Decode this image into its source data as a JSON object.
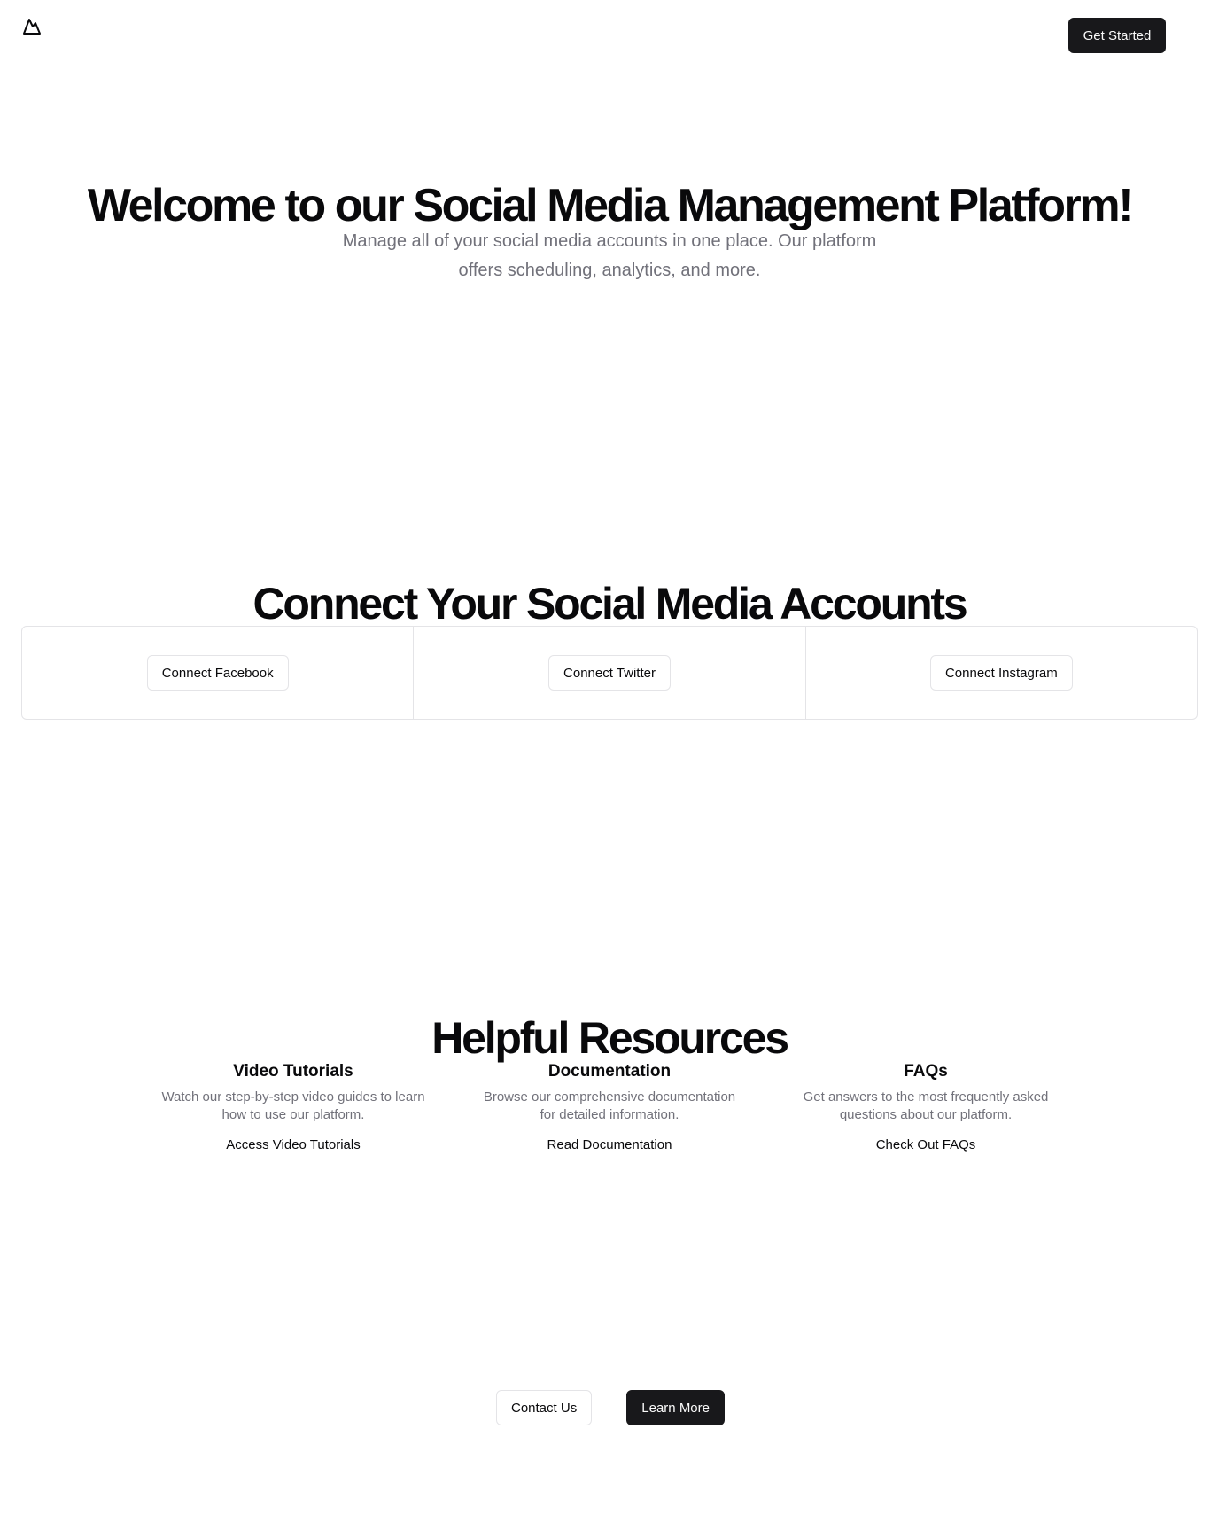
{
  "header": {
    "logo_icon": "mountain-icon",
    "cta_label": "Get Started"
  },
  "hero": {
    "title": "Welcome to our Social Media Management Platform!",
    "subtitle": "Manage all of your social media accounts in one place. Our platform offers scheduling, analytics, and more."
  },
  "connect": {
    "title": "Connect Your Social Media Accounts",
    "buttons": [
      {
        "label": "Connect Facebook"
      },
      {
        "label": "Connect Twitter"
      },
      {
        "label": "Connect Instagram"
      }
    ]
  },
  "resources": {
    "title": "Helpful Resources",
    "items": [
      {
        "heading": "Video Tutorials",
        "description": "Watch our step-by-step video guides to learn how to use our platform.",
        "link": "Access Video Tutorials"
      },
      {
        "heading": "Documentation",
        "description": "Browse our comprehensive documentation for detailed information.",
        "link": "Read Documentation"
      },
      {
        "heading": "FAQs",
        "description": "Get answers to the most frequently asked questions about our platform.",
        "link": "Check Out FAQs"
      }
    ]
  },
  "footer": {
    "contact_label": "Contact Us",
    "learn_more_label": "Learn More"
  },
  "colors": {
    "primary": "#18181b",
    "muted_text": "#71717a",
    "border": "#e4e4e7",
    "background": "#ffffff"
  }
}
